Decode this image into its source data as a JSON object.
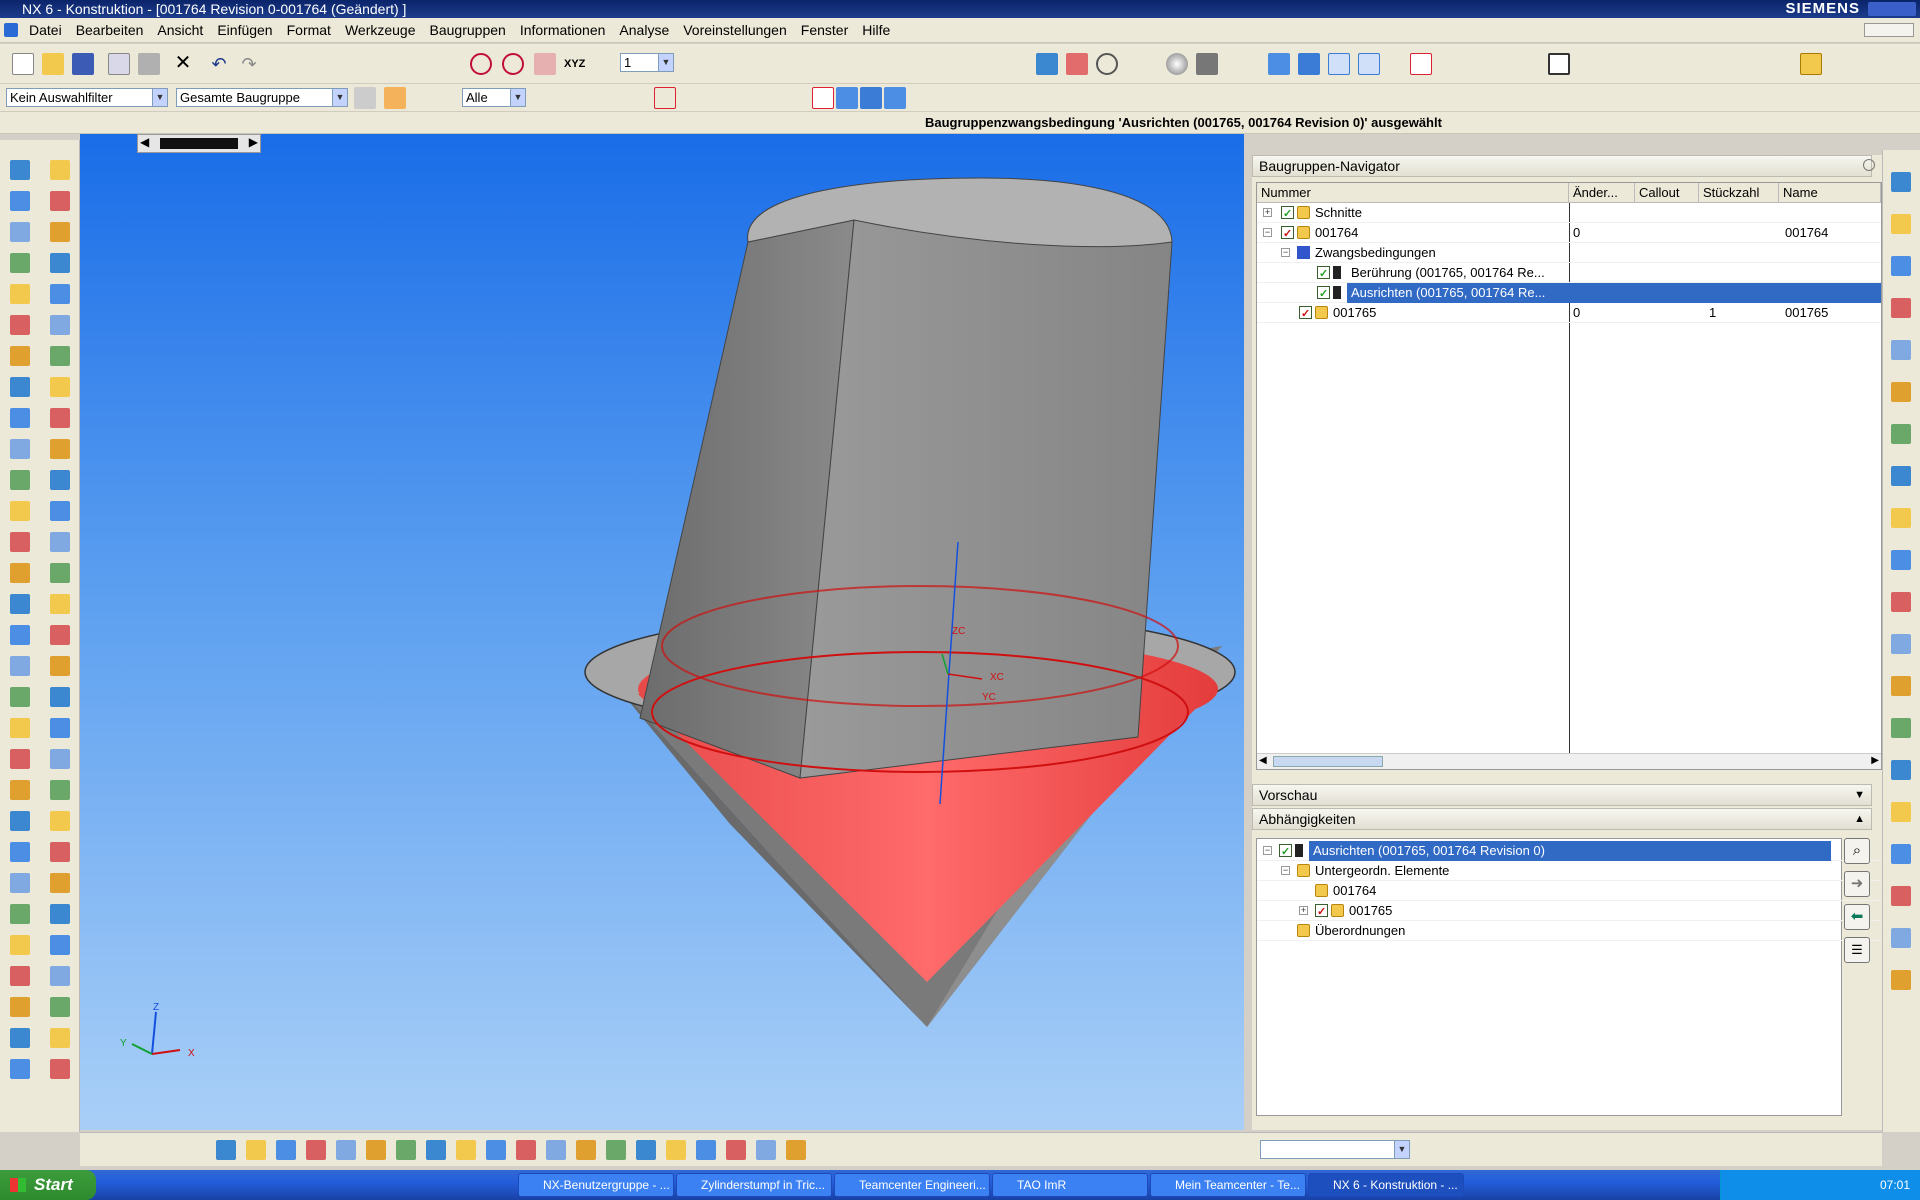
{
  "window": {
    "title": "NX 6 - Konstruktion - [001764 Revision 0-001764 (Geändert) ]",
    "brand": "SIEMENS"
  },
  "menu": [
    "Datei",
    "Bearbeiten",
    "Ansicht",
    "Einfügen",
    "Format",
    "Werkzeuge",
    "Baugruppen",
    "Informationen",
    "Analyse",
    "Voreinstellungen",
    "Fenster",
    "Hilfe"
  ],
  "toolbar": {
    "layer_value": "1",
    "filter_value": "Kein Auswahlfilter",
    "scope_value": "Gesamte Baugruppe",
    "type_value": "Alle"
  },
  "status": {
    "message": "Baugruppenzwangsbedingung 'Ausrichten (001765, 001764 Revision 0)' ausgewählt"
  },
  "navigator": {
    "title": "Baugruppen-Navigator",
    "columns": [
      "Nummer",
      "Änder...",
      "Callout",
      "Stückzahl",
      "Name"
    ],
    "rows": [
      {
        "label": "Schnitte",
        "aender": "",
        "callout": "",
        "stueck": "",
        "name": ""
      },
      {
        "label": "001764",
        "aender": "0",
        "callout": "",
        "stueck": "",
        "name": "001764"
      },
      {
        "label": "Zwangsbedingungen",
        "aender": "",
        "callout": "",
        "stueck": "",
        "name": ""
      },
      {
        "label": "Berührung (001765, 001764 Re...",
        "aender": "",
        "callout": "",
        "stueck": "",
        "name": ""
      },
      {
        "label": "Ausrichten (001765, 001764 Re...",
        "aender": "",
        "callout": "",
        "stueck": "",
        "name": ""
      },
      {
        "label": "001765",
        "aender": "0",
        "callout": "",
        "stueck": "1",
        "name": "001765"
      }
    ]
  },
  "preview": {
    "title": "Vorschau"
  },
  "dependencies": {
    "title": "Abhängigkeiten",
    "rows": [
      {
        "label": "Ausrichten (001765, 001764 Revision 0)"
      },
      {
        "label": "Untergeordn. Elemente"
      },
      {
        "label": "001764"
      },
      {
        "label": "001765"
      },
      {
        "label": "Überordnungen"
      }
    ]
  },
  "viewport": {
    "axis_labels": {
      "z": "Z",
      "y": "Y",
      "x": "X"
    },
    "csys_labels": {
      "zc": "ZC",
      "xc": "XC",
      "yc": "YC"
    }
  },
  "taskbar": {
    "start": "Start",
    "tasks": [
      "NX-Benutzergruppe - ...",
      "Zylinderstumpf in Tric...",
      "Teamcenter Engineeri...",
      "TAO ImR",
      "Mein Teamcenter - Te...",
      "NX 6 - Konstruktion - ..."
    ],
    "clock": "07:01"
  }
}
